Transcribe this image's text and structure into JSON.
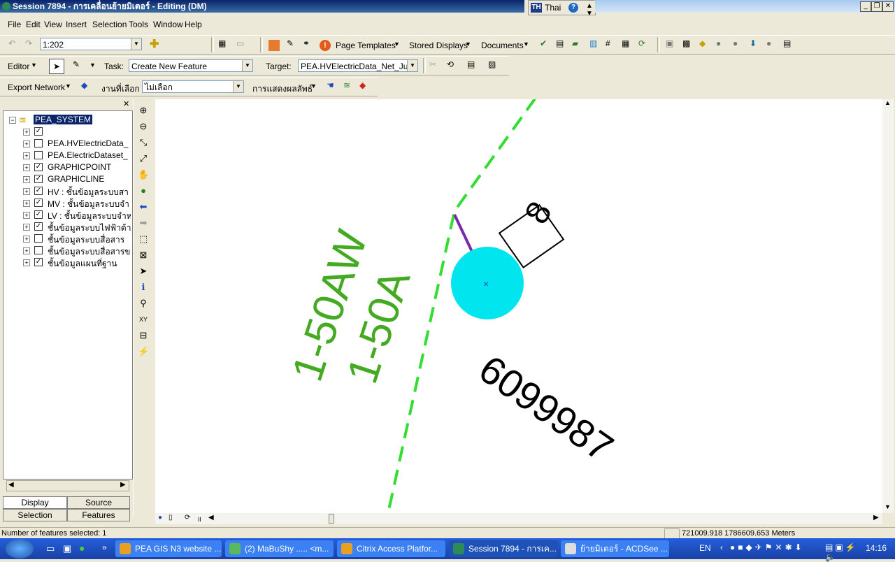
{
  "window": {
    "title": "Session 7894 - การเคลื่อนย้ายมิเตอร์ - Editing (DM)"
  },
  "langbar": {
    "code": "TH",
    "label": "Thai",
    "help": "?"
  },
  "menu": [
    "File",
    "Edit",
    "View",
    "Insert",
    "Selection",
    "Tools",
    "Window",
    "Help"
  ],
  "standard_toolbar": {
    "scale": "1:202",
    "page_templates": "Page Templates",
    "stored_displays": "Stored Displays",
    "documents": "Documents"
  },
  "editor_toolbar": {
    "editor_label": "Editor",
    "task_label": "Task:",
    "task_value": "Create New Feature",
    "target_label": "Target:",
    "target_value": "PEA.HVElectricData_Net_Ju"
  },
  "network_toolbar": {
    "export_network": "Export Network",
    "job_label": "งานที่เลือก",
    "job_value": "ไม่เลือก",
    "show_result": "การแสดงผลลัพธ์"
  },
  "toc": {
    "root": "PEA_SYSTEM",
    "layers": [
      {
        "label": "",
        "checked": true
      },
      {
        "label": "PEA.HVElectricData_",
        "checked": false
      },
      {
        "label": "PEA.ElectricDataset_",
        "checked": false
      },
      {
        "label": "GRAPHICPOINT",
        "checked": true
      },
      {
        "label": "GRAPHICLINE",
        "checked": true
      },
      {
        "label": "HV : ชั้นข้อมูลระบบสา",
        "checked": true
      },
      {
        "label": "MV : ชั้นข้อมูลระบบจำ",
        "checked": true
      },
      {
        "label": "LV : ชั้นข้อมูลระบบจำห",
        "checked": true
      },
      {
        "label": "ชั้นข้อมูลระบบไฟฟ้าด้าน",
        "checked": true
      },
      {
        "label": "ชั้นข้อมูลระบบสื่อสาร",
        "checked": false
      },
      {
        "label": "ชั้นข้อมูลระบบสื่อสารข",
        "checked": false
      },
      {
        "label": "ชั้นข้อมูลแผนที่ฐาน",
        "checked": true
      }
    ],
    "tabs": [
      "Display",
      "Source",
      "Selection",
      "Features"
    ]
  },
  "map": {
    "label_line1": "1-50AW",
    "label_line2": "1-50A",
    "meter_label": "8",
    "meter_number": "6099987",
    "line_color": "#33dd33",
    "label_color": "#44aa22",
    "meter_color": "#00e5ee",
    "service_color": "#7a2aa8"
  },
  "status": {
    "message": "Number of features selected: 1",
    "coordinates": "721009.918  1786609.653 Meters"
  },
  "taskbar": {
    "tasks": [
      "PEA GIS N3 website ...",
      "(2) MaBuShy ..... <m...",
      "Citrix Access Platfor...",
      "Session 7894 - การเค...",
      "ย้ายมิเตอร์ - ACDSee ..."
    ],
    "lang": "EN",
    "clock": "14:16"
  }
}
